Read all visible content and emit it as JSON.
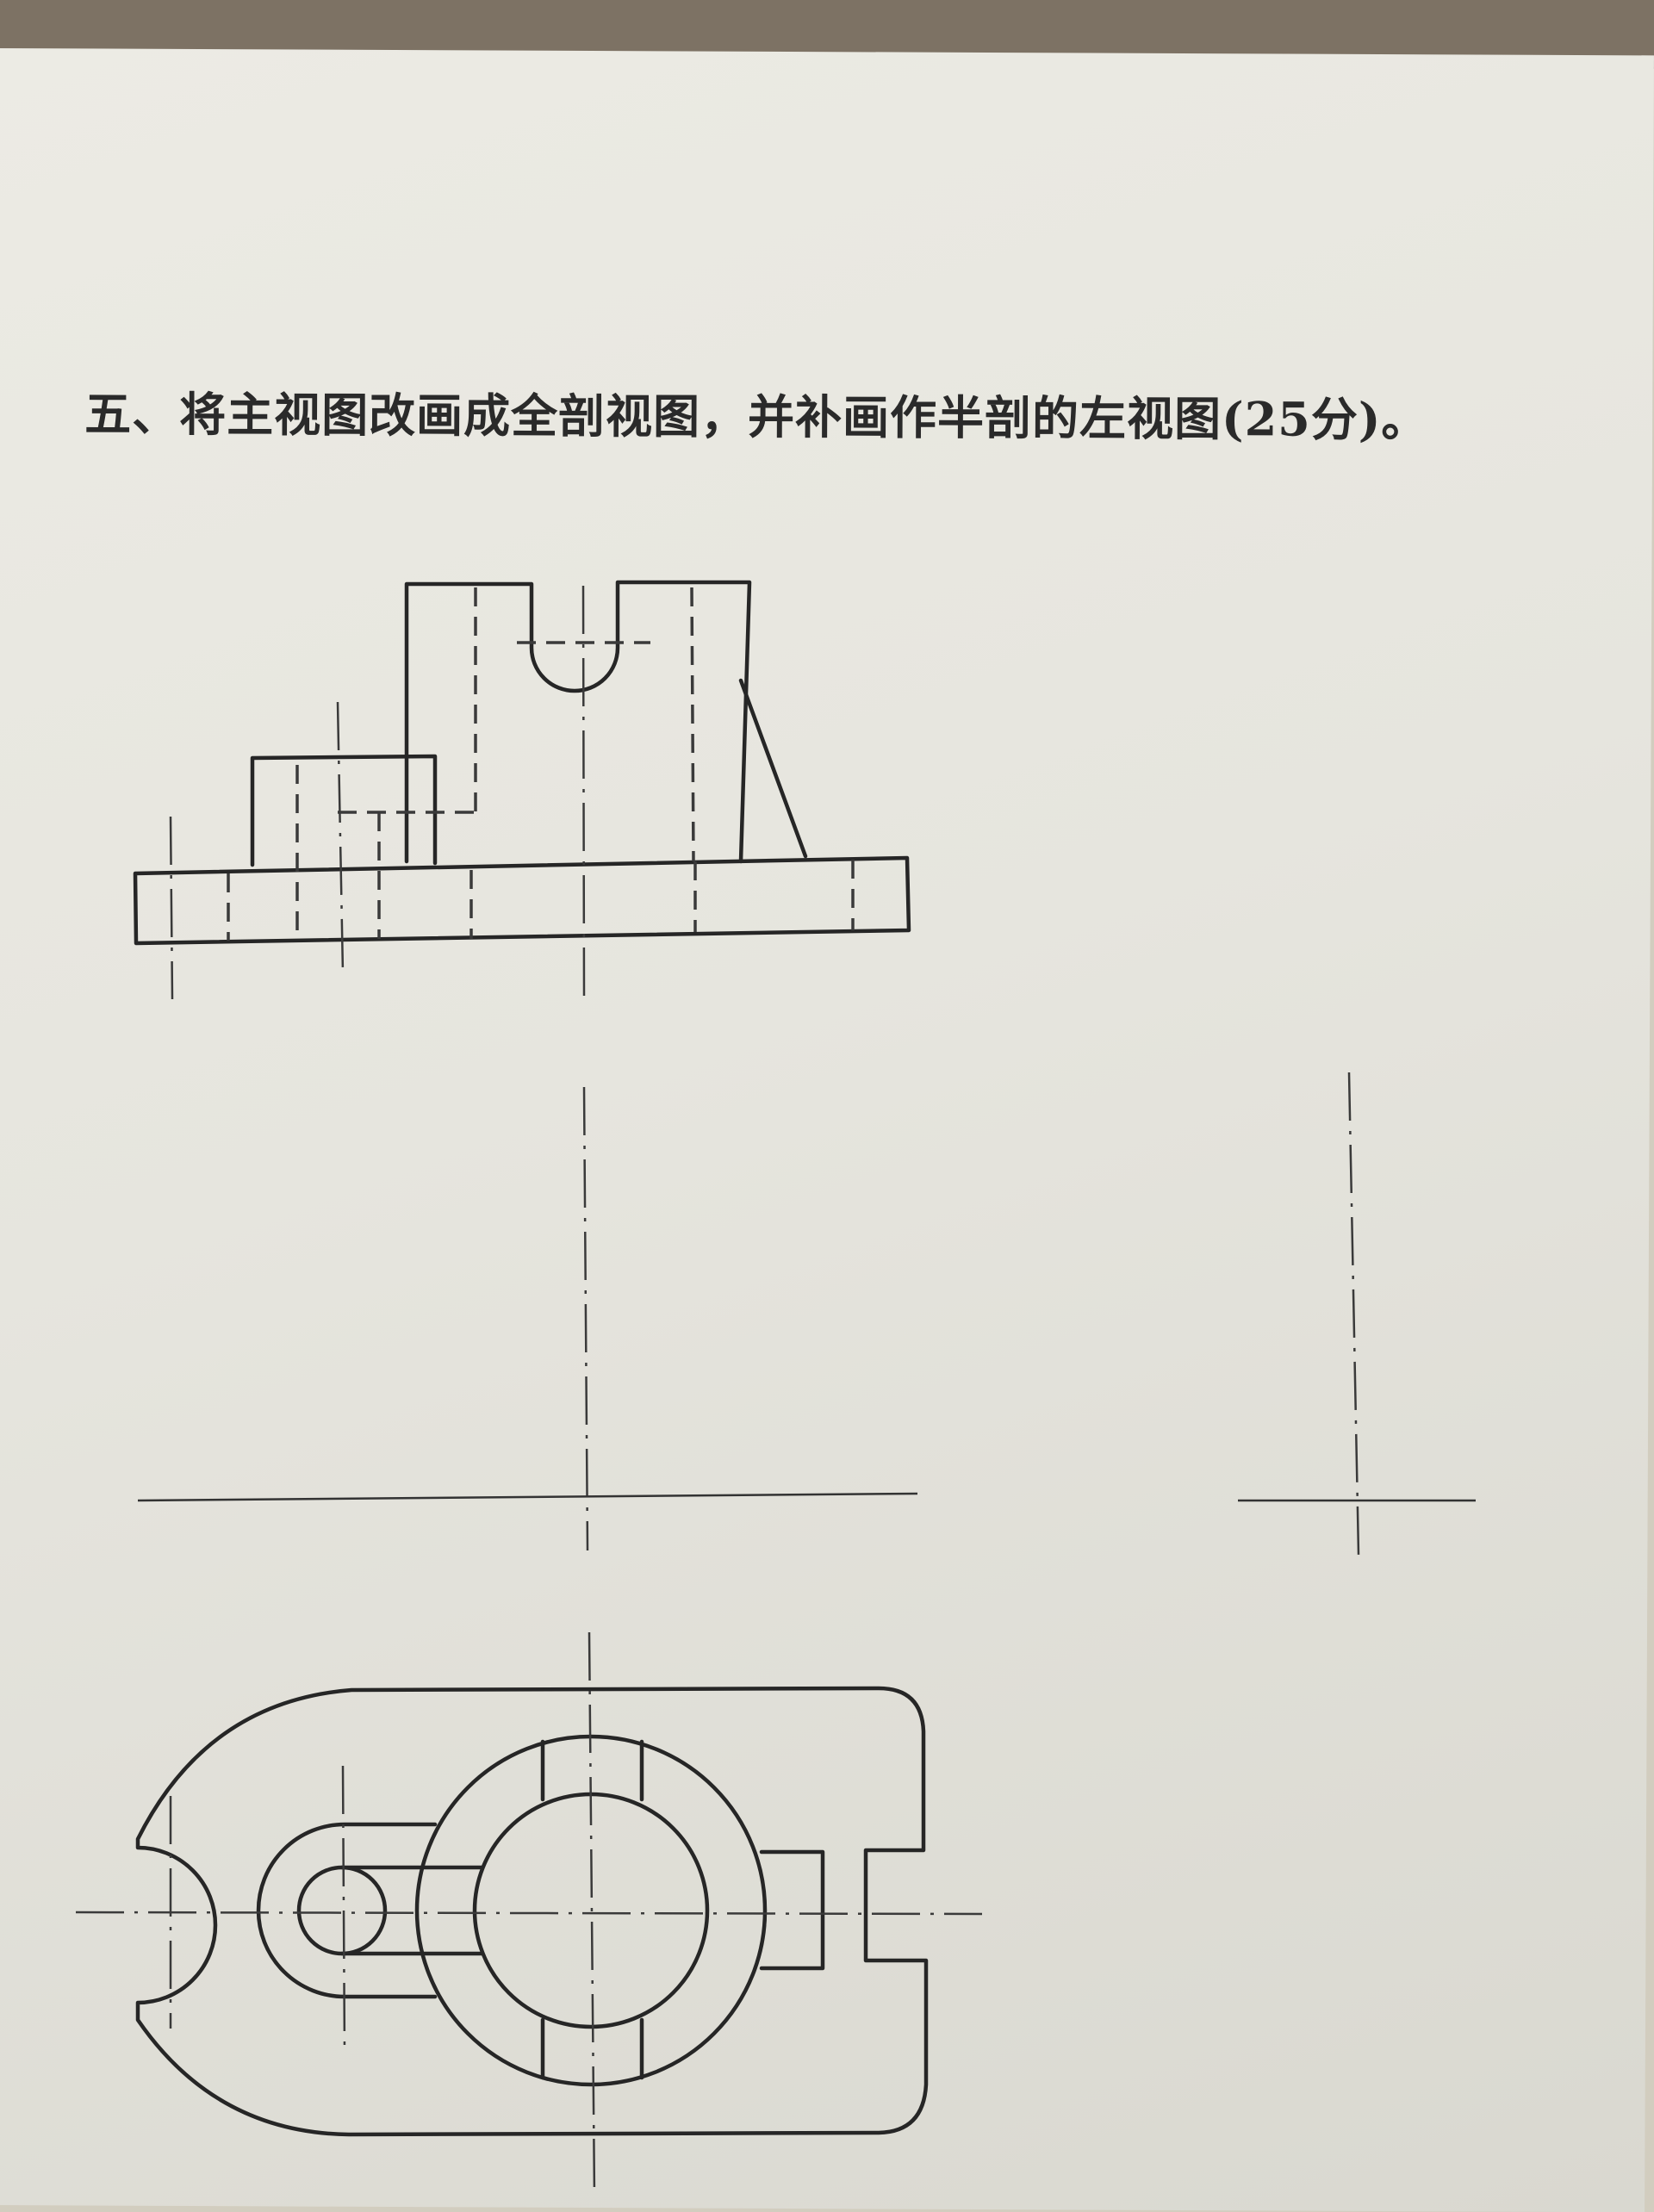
{
  "question": {
    "text": "五、将主视图改画成全剖视图，并补画作半剖的左视图(25分)。"
  },
  "colors": {
    "paper": "#e8e7e0",
    "ink": "#262626",
    "table": "#7d7264"
  },
  "views": [
    "front-view",
    "side-view-axes",
    "top-view"
  ]
}
